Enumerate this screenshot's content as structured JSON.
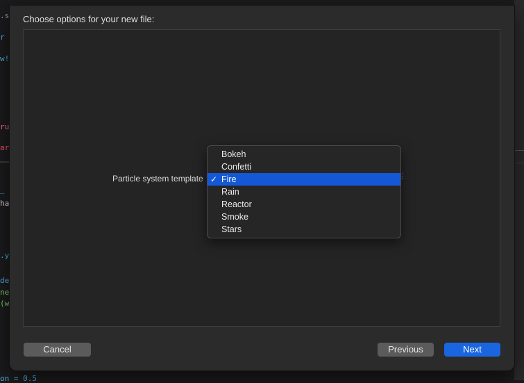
{
  "background_code": {
    "line1": ".sw",
    "line2": "r",
    "line3": "w!",
    "line4": "ru",
    "line5": "ar",
    "line6": "_",
    "line7": "ha",
    "line8": ".y",
    "line9": "de",
    "line10": "ne",
    "line11": "(w",
    "bottom": "on = 0.5"
  },
  "sheet": {
    "title": "Choose options for your new file:",
    "field_label": "Particle system template",
    "menu_items": [
      {
        "label": "Bokeh",
        "selected": false
      },
      {
        "label": "Confetti",
        "selected": false
      },
      {
        "label": "Fire",
        "selected": true
      },
      {
        "label": "Rain",
        "selected": false
      },
      {
        "label": "Reactor",
        "selected": false
      },
      {
        "label": "Smoke",
        "selected": false
      },
      {
        "label": "Stars",
        "selected": false
      }
    ],
    "check_glyph": "✓",
    "popup_caret": "⋮"
  },
  "buttons": {
    "cancel": "Cancel",
    "previous": "Previous",
    "next": "Next"
  },
  "colors": {
    "accent": "#1458d6",
    "next_button": "#1a66e0"
  }
}
